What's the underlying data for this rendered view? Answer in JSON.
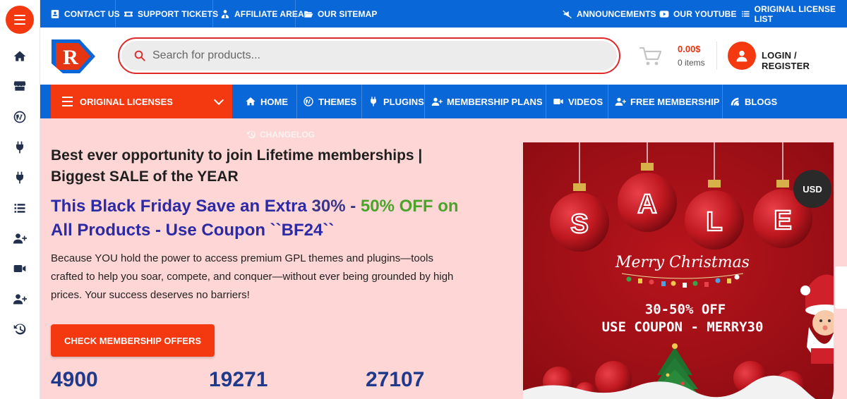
{
  "topbar": {
    "left": [
      {
        "label": "CONTACT US",
        "icon": "contact-card-icon"
      },
      {
        "label": "SUPPORT TICKETS",
        "icon": "ticket-icon"
      },
      {
        "label": "AFFILIATE AREA",
        "icon": "user-tie-icon"
      },
      {
        "label": "OUR SITEMAP",
        "icon": "folder-open-icon"
      }
    ],
    "right": [
      {
        "label": "ANNOUNCEMENTS",
        "icon": "megaphone-off-icon"
      },
      {
        "label": "OUR YOUTUBE",
        "icon": "youtube-icon"
      },
      {
        "label": "ORIGINAL LICENSE LIST",
        "icon": "list-icon"
      }
    ]
  },
  "header": {
    "logo_letter": "R",
    "search_placeholder": "Search for products...",
    "cart_price": "0.00$",
    "cart_items": "0 items",
    "login_label": "LOGIN / REGISTER"
  },
  "nav": {
    "dropdown_label": "ORIGINAL LICENSES",
    "items": [
      {
        "label": "HOME",
        "icon": "home-icon"
      },
      {
        "label": "THEMES",
        "icon": "wordpress-icon"
      },
      {
        "label": "PLUGINS",
        "icon": "plug-icon"
      },
      {
        "label": "MEMBERSHIP PLANS",
        "icon": "user-plus-icon"
      },
      {
        "label": "VIDEOS",
        "icon": "video-icon"
      },
      {
        "label": "FREE MEMBERSHIP",
        "icon": "user-plus-icon"
      },
      {
        "label": "BLOGS",
        "icon": "blog-icon"
      }
    ],
    "changelog": "CHANGELOG"
  },
  "hero": {
    "title": "Best ever opportunity to join Lifetime memberships | Biggest SALE of the YEAR",
    "promo_part1": "This Black Friday Save an Extra ",
    "promo_pct1": "30%",
    "promo_dash": " - ",
    "promo_pct2": "50% OFF",
    "promo_on": " on",
    "promo_part2": "All Products - Use Coupon ``BF24``",
    "description": "Because YOU hold the power to access premium GPL themes and plugins—tools crafted to help you soar, compete, and conquer—without ever being grounded by high prices. Your success deserves no barriers!",
    "cta": "CHECK MEMBERSHIP OFFERS",
    "stats": [
      "4900",
      "19271",
      "27107"
    ]
  },
  "banner": {
    "letters": [
      "S",
      "A",
      "L",
      "E"
    ],
    "greeting": "Merry Christmas",
    "discount": "30-50% OFF",
    "coupon": "USE COUPON - MERRY30"
  },
  "currency": "USD",
  "colors": {
    "brand_blue": "#0a67d8",
    "brand_orange": "#f4380f",
    "hero_bg": "#ffd6d6",
    "banner_red": "#a90f17"
  },
  "rail_icons": [
    "menu-icon",
    "home-icon",
    "store-icon",
    "wordpress-icon",
    "plug-icon",
    "plug-icon",
    "list-icon",
    "user-plus-icon",
    "video-icon",
    "user-plus-icon",
    "history-icon"
  ]
}
